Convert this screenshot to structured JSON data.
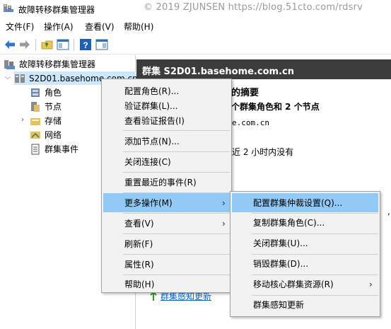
{
  "window": {
    "title": "故障转移群集管理器",
    "watermark": "© 2019 ZJUNSEN https://blog.51cto.com/rdsrv"
  },
  "menubar": {
    "items": [
      "文件(F)",
      "操作(A)",
      "查看(V)",
      "帮助(H)"
    ]
  },
  "toolbar": {
    "buttons": [
      "back-arrow-icon",
      "forward-arrow-icon",
      "up-folder-icon",
      "show-pane-icon",
      "help-icon",
      "console-pane-icon"
    ]
  },
  "tree": {
    "root_label": "故障转移群集管理器",
    "cluster_label": "S2D01.basehome.com.cn",
    "children": [
      "角色",
      "节点",
      "存储",
      "网络",
      "群集事件"
    ]
  },
  "right_pane": {
    "header": "群集 S2D01.basehome.com.cn",
    "summary_title": "的摘要",
    "summary_line": "个群集角色和 2 个节点",
    "domain_fragment": "e.com.cn",
    "hours_fragment": "近 2 小时内没有",
    "comma": ",",
    "link_text": "群集感知更新"
  },
  "context_menu": {
    "items": [
      "配置角色(R)...",
      "验证群集(L)...",
      "查看验证报告(I)",
      "添加节点(N)...",
      "关闭连接(C)",
      "重置最近的事件(R)",
      "更多操作(M)",
      "查看(V)",
      "刷新(F)",
      "属性(R)",
      "帮助(H)"
    ]
  },
  "submenu": {
    "items": [
      "配置群集仲裁设置(Q)...",
      "复制群集角色(C)...",
      "关闭群集(U)...",
      "销毁群集(D)...",
      "移动核心群集资源(R)",
      "群集感知更新"
    ]
  },
  "colors": {
    "menu_highlight": "#91c9f7",
    "tree_selection": "#cce8ff",
    "header_bg": "#3c3c3c",
    "link": "#0066cc"
  }
}
